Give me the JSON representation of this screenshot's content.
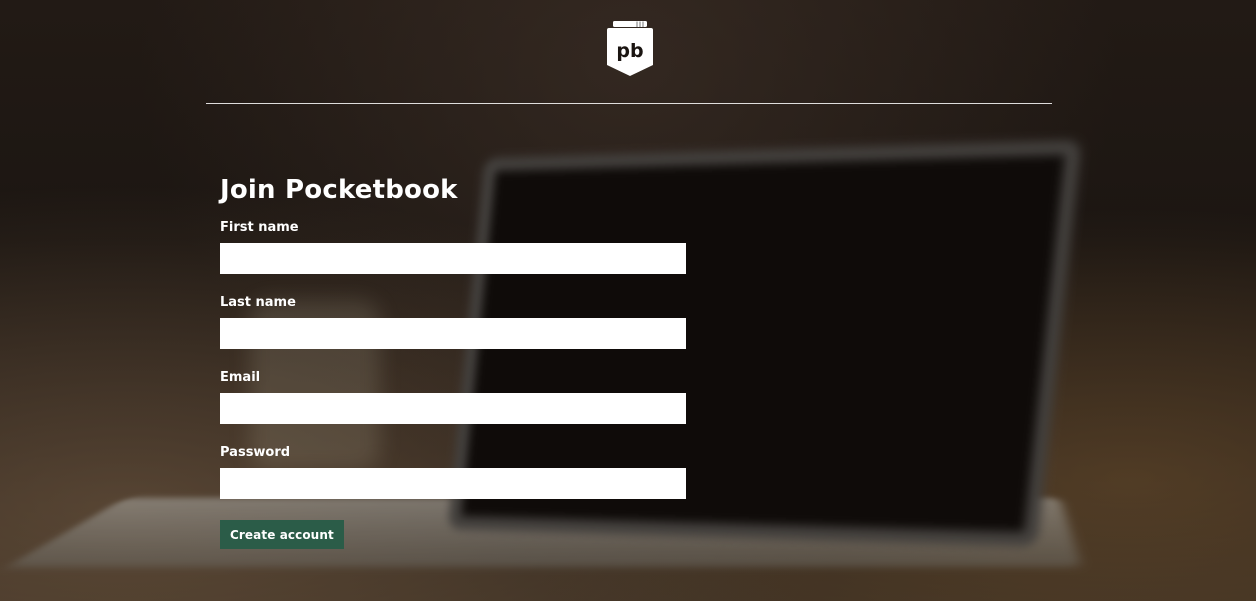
{
  "brand": {
    "logo_text": "pb"
  },
  "form": {
    "title": "Join Pocketbook",
    "fields": [
      {
        "label": "First name",
        "value": "",
        "placeholder": ""
      },
      {
        "label": "Last name",
        "value": "",
        "placeholder": ""
      },
      {
        "label": "Email",
        "value": "",
        "placeholder": ""
      },
      {
        "label": "Password",
        "value": "",
        "placeholder": ""
      }
    ],
    "submit_label": "Create account"
  },
  "colors": {
    "button_bg": "#2b5c48",
    "text": "#ffffff",
    "input_bg": "#ffffff"
  },
  "icons": {
    "logo": "pocketbook-logo-icon"
  }
}
